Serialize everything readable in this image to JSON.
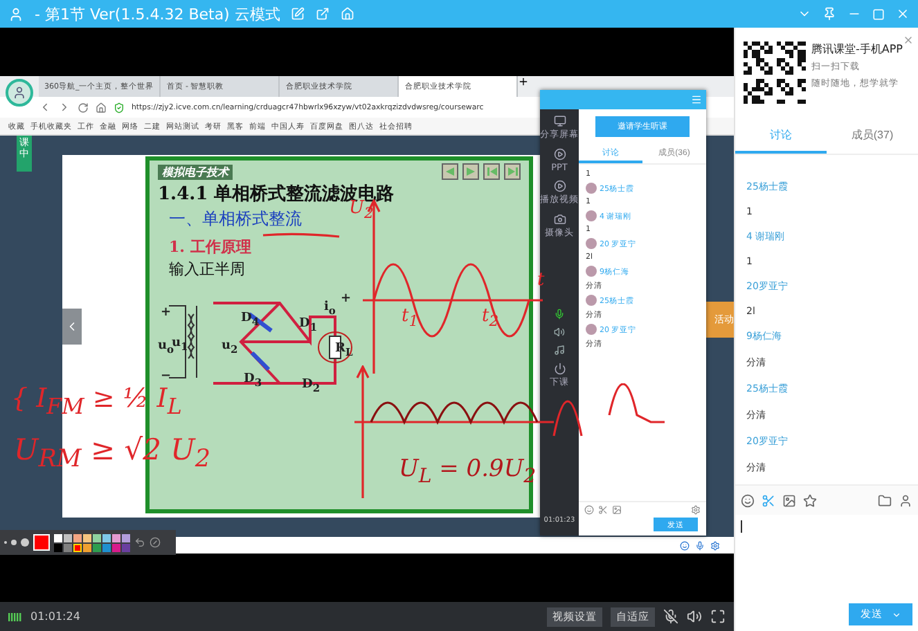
{
  "window": {
    "title": "- 第1节 Ver(1.5.4.32 Beta) 云模式"
  },
  "shared_screen": {
    "browser": {
      "tabs": [
        {
          "label": "360导航_一个主页，整个世界",
          "selected": false
        },
        {
          "label": "首页 - 智慧职教",
          "selected": false
        },
        {
          "label": "合肥职业技术学院",
          "selected": false
        },
        {
          "label": "合肥职业技术学院",
          "selected": true
        }
      ],
      "url": "https://zjy2.icve.com.cn/learning/crduagcr47hbwrlx96xzyw/vt02axkrqzizdvdwsreg/coursewarc",
      "bookmarks": [
        "收藏",
        "手机收藏夹",
        "工作",
        "金融",
        "网络",
        "二建",
        "网站测试",
        "考研",
        "黑客",
        "前端",
        "中国人寿",
        "百度网盘",
        "图八达",
        "社会招聘"
      ]
    },
    "page": {
      "badge": "课中",
      "side_tile": "活动",
      "slide": {
        "header": "模拟电子技术",
        "title": "1.4.1  单相桥式整流滤波电路",
        "section": "一、单相桥式整流",
        "subsection": "1. 工作原理",
        "caption": "输入正半周",
        "circuit_labels": [
          "+",
          "u$_{o}$",
          "u$_{1}$",
          "u$_{2}$",
          "−",
          "D$_{4}$",
          "D$_{1}$",
          "D$_{3}$",
          "D$_{2}$",
          "R$_{L}$",
          "i$_{o}$",
          "+"
        ]
      }
    },
    "handwriting": {
      "notes": [
        "{ I$_{FM}$ ≥ ½ I$_{L}$",
        "U$_{RM}$ ≥ √2 U$_{2}$",
        "U$_{L}$ = 0.9U$_{2}$"
      ],
      "graph_labels": [
        "U$_{2}$",
        "t$_{1}$",
        "t$_{2}$",
        "t"
      ]
    },
    "classroom_panel": {
      "tools": [
        "分享屏幕",
        "PPT",
        "播放视频",
        "摄像头"
      ],
      "end_label": "下课",
      "clock": "01:01:23",
      "invite_button": "邀请学生听课",
      "tabs": [
        {
          "label": "讨论",
          "selected": true
        },
        {
          "label": "成员(36)",
          "selected": false
        }
      ],
      "messages": [
        {
          "text": "1"
        },
        {
          "name": "25杨士霞",
          "text": "1"
        },
        {
          "name": "4 谢瑞刚",
          "text": "1"
        },
        {
          "name": "20 罗亚宁",
          "text": "2l"
        },
        {
          "name": "9杨仁海",
          "text": "分清"
        },
        {
          "name": "25杨士霞",
          "text": "分清"
        },
        {
          "name": "20 罗亚宁",
          "text": "分清"
        }
      ],
      "send_button": "发送"
    },
    "palette": {
      "swatches": [
        {
          "color": "#ffffff",
          "selected": false
        },
        {
          "color": "#c0c0c0",
          "selected": false
        },
        {
          "color": "#f4a582",
          "selected": false
        },
        {
          "color": "#f6c57f",
          "selected": false
        },
        {
          "color": "#8fd19e",
          "selected": false
        },
        {
          "color": "#7fc8e8",
          "selected": false
        },
        {
          "color": "#e39ad0",
          "selected": false
        },
        {
          "color": "#b39ddb",
          "selected": false
        },
        {
          "color": "#000000",
          "selected": false
        },
        {
          "color": "#808080",
          "selected": false
        },
        {
          "color": "#ff0000",
          "selected": true
        },
        {
          "color": "#f0a030",
          "selected": false
        },
        {
          "color": "#2e9e4f",
          "selected": false
        },
        {
          "color": "#1e90d0",
          "selected": false
        },
        {
          "color": "#d81b8c",
          "selected": false
        },
        {
          "color": "#6a3fa0",
          "selected": false
        }
      ]
    }
  },
  "side_panel": {
    "promo": {
      "title": "腾讯课堂-手机APP",
      "lines": [
        "扫一扫下载",
        "随时随地，想学就学"
      ]
    },
    "tabs": [
      {
        "label": "讨论",
        "selected": true
      },
      {
        "label": "成员(37)",
        "selected": false
      }
    ],
    "messages": [
      {
        "name": "25杨士霞",
        "text": "1"
      },
      {
        "name": "4 谢瑞刚",
        "text": "1"
      },
      {
        "name": "20罗亚宁",
        "text": "2l"
      },
      {
        "name": "9杨仁海",
        "text": "分清"
      },
      {
        "name": "25杨士霞",
        "text": "分清"
      },
      {
        "name": "20罗亚宁",
        "text": "分清"
      }
    ],
    "send_button": "发送"
  },
  "bottom_bar": {
    "time": "01:01:24",
    "buttons": [
      "视频设置",
      "自适应"
    ]
  }
}
